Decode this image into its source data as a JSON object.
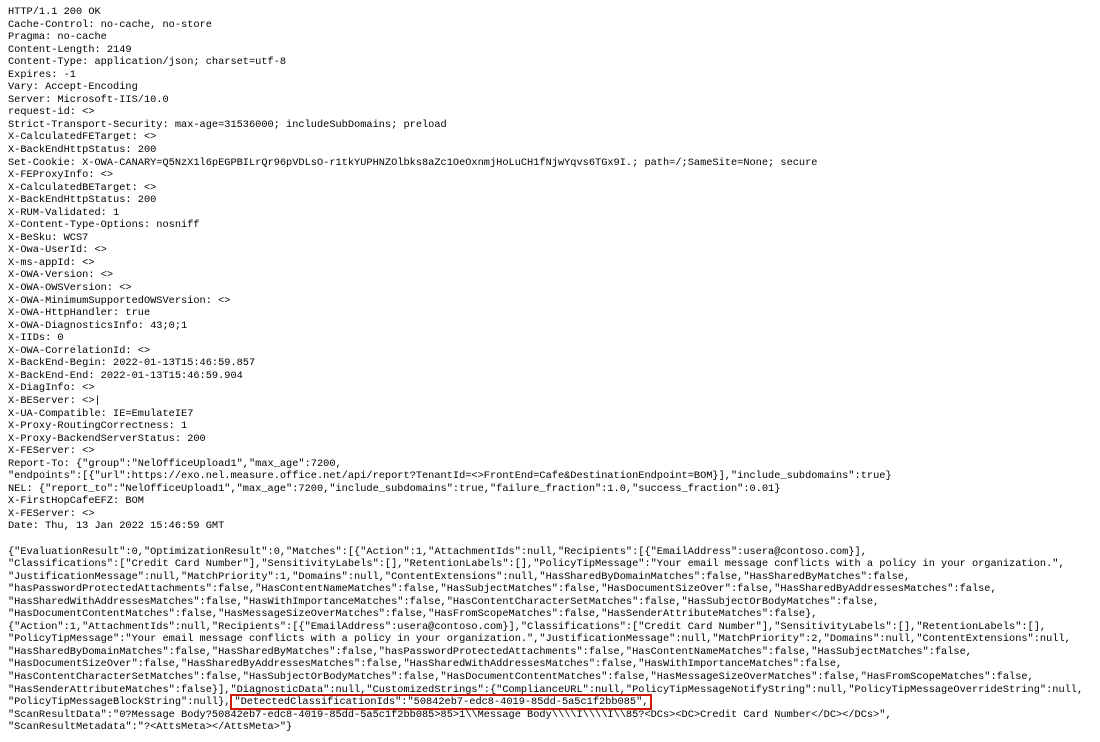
{
  "http": {
    "status_line": "HTTP/1.1 200 OK",
    "headers": [
      "Cache-Control: no-cache, no-store",
      "Pragma: no-cache",
      "Content-Length: 2149",
      "Content-Type: application/json; charset=utf-8",
      "Expires: -1",
      "Vary: Accept-Encoding",
      "Server: Microsoft-IIS/10.0",
      "request-id: <>",
      "Strict-Transport-Security: max-age=31536000; includeSubDomains; preload",
      "X-CalculatedFETarget: <>",
      "X-BackEndHttpStatus: 200",
      "Set-Cookie: X-OWA-CANARY=Q5NzX1l6pEGPBILrQr96pVDLsO-r1tkYUPHNZOlbks8aZc1OeOxnmjHoLuCH1fNjwYqvs6TGx9I.; path=/;SameSite=None; secure",
      "X-FEProxyInfo: <>",
      "X-CalculatedBETarget: <>",
      "X-BackEndHttpStatus: 200",
      "X-RUM-Validated: 1",
      "X-Content-Type-Options: nosniff",
      "X-BeSku: WCS7",
      "X-Owa-UserId: <>",
      "X-ms-appId: <>",
      "X-OWA-Version: <>",
      "X-OWA-OWSVersion: <>",
      "X-OWA-MinimumSupportedOWSVersion: <>",
      "X-OWA-HttpHandler: true",
      "X-OWA-DiagnosticsInfo: 43;0;1",
      "X-IIDs: 0",
      "X-OWA-CorrelationId: <>",
      "X-BackEnd-Begin: 2022-01-13T15:46:59.857",
      "X-BackEnd-End: 2022-01-13T15:46:59.904",
      "X-DiagInfo: <>",
      "X-BEServer: <>|",
      "X-UA-Compatible: IE=EmulateIE7",
      "X-Proxy-RoutingCorrectness: 1",
      "X-Proxy-BackendServerStatus: 200",
      "X-FEServer: <>",
      "Report-To: {\"group\":\"NelOfficeUpload1\",\"max_age\":7200,",
      "\"endpoints\":[{\"url\":https://exo.nel.measure.office.net/api/report?TenantId=<>FrontEnd=Cafe&DestinationEndpoint=BOM}],\"include_subdomains\":true}",
      "NEL: {\"report_to\":\"NelOfficeUpload1\",\"max_age\":7200,\"include_subdomains\":true,\"failure_fraction\":1.0,\"success_fraction\":0.01}",
      "X-FirstHopCafeEFZ: BOM",
      "X-FEServer: <>",
      "Date: Thu, 13 Jan 2022 15:46:59 GMT"
    ]
  },
  "body": {
    "before_highlight": "{\"EvaluationResult\":0,\"OptimizationResult\":0,\"Matches\":[{\"Action\":1,\"AttachmentIds\":null,\"Recipients\":[{\"EmailAddress\":usera@contoso.com}],\n\"Classifications\":[\"Credit Card Number\"],\"SensitivityLabels\":[],\"RetentionLabels\":[],\"PolicyTipMessage\":\"Your email message conflicts with a policy in your organization.\",\n\"JustificationMessage\":null,\"MatchPriority\":1,\"Domains\":null,\"ContentExtensions\":null,\"HasSharedByDomainMatches\":false,\"HasSharedByMatches\":false,\n\"hasPasswordProtectedAttachments\":false,\"HasContentNameMatches\":false,\"HasSubjectMatches\":false,\"HasDocumentSizeOver\":false,\"HasSharedByAddressesMatches\":false,\n\"HasSharedWithAddressesMatches\":false,\"HasWithImportanceMatches\":false,\"HasContentCharacterSetMatches\":false,\"HasSubjectOrBodyMatches\":false,\n\"HasDocumentContentMatches\":false,\"HasMessageSizeOverMatches\":false,\"HasFromScopeMatches\":false,\"HasSenderAttributeMatches\":false},\n{\"Action\":1,\"AttachmentIds\":null,\"Recipients\":[{\"EmailAddress\":usera@contoso.com}],\"Classifications\":[\"Credit Card Number\"],\"SensitivityLabels\":[],\"RetentionLabels\":[],\n\"PolicyTipMessage\":\"Your email message conflicts with a policy in your organization.\",\"JustificationMessage\":null,\"MatchPriority\":2,\"Domains\":null,\"ContentExtensions\":null,\n\"HasSharedByDomainMatches\":false,\"HasSharedByMatches\":false,\"hasPasswordProtectedAttachments\":false,\"HasContentNameMatches\":false,\"HasSubjectMatches\":false,\n\"HasDocumentSizeOver\":false,\"HasSharedByAddressesMatches\":false,\"HasSharedWithAddressesMatches\":false,\"HasWithImportanceMatches\":false,\n\"HasContentCharacterSetMatches\":false,\"HasSubjectOrBodyMatches\":false,\"HasDocumentContentMatches\":false,\"HasMessageSizeOverMatches\":false,\"HasFromScopeMatches\":false,\n\"HasSenderAttributeMatches\":false}],\"DiagnosticData\":null,\"CustomizedStrings\":{\"ComplianceURL\":null,\"PolicyTipMessageNotifyString\":null,\"PolicyTipMessageOverrideString\":null,\n\"PolicyTipMessageBlockString\":null},",
    "highlight": "\"DetectedClassificationIds\":\"50842eb7-edc8-4019-85dd-5a5c1f2bb085\",",
    "after_highlight": "\n\"ScanResultData\":\"0?Message Body?50842eb7-edc8-4019-85dd-5a5c1f2bb085>85>1\\\\Message Body\\\\\\\\I\\\\\\\\I\\\\85?<DCs><DC>Credit Card Number</DC></DCs>\",\n\"ScanResultMetadata\":\"?<AttsMeta></AttsMeta>\"}"
  }
}
